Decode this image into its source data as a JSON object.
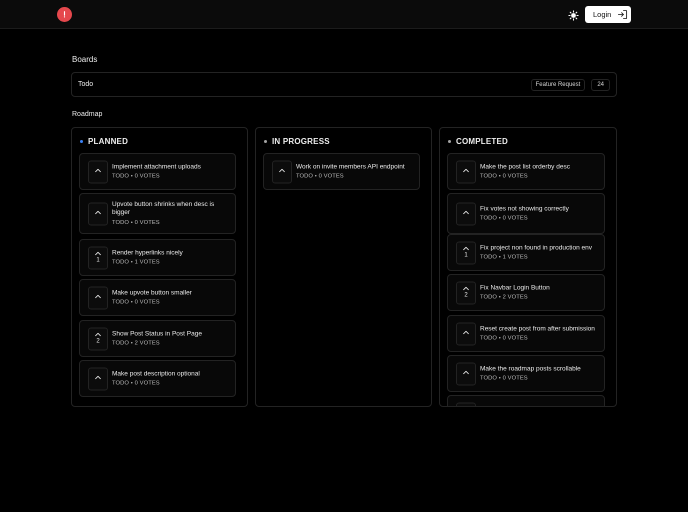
{
  "header": {
    "login_label": "Login"
  },
  "sections": {
    "boards": "Boards",
    "roadmap": "Roadmap"
  },
  "board": {
    "name": "Todo",
    "tag": "Feature Request",
    "count": "24"
  },
  "colors": {
    "accent_red": "#e5484d",
    "planned": "#3b82f6",
    "in_progress": "#a3a3a3",
    "completed": "#a3a3a3"
  },
  "columns": [
    {
      "title": "PLANNED",
      "cards": [
        {
          "title": "Implement attachment uploads",
          "meta": "TODO • 0 VOTES",
          "votes": ""
        },
        {
          "title": "Upvote button shrinks when desc is bigger",
          "meta": "TODO • 0 VOTES",
          "votes": ""
        },
        {
          "title": "Render hyperlinks nicely",
          "meta": "TODO • 1 VOTES",
          "votes": "1"
        },
        {
          "title": "Make upvote button smaller",
          "meta": "TODO • 0 VOTES",
          "votes": ""
        },
        {
          "title": "Show Post Status in Post Page",
          "meta": "TODO • 2 VOTES",
          "votes": "2"
        },
        {
          "title": "Make post description optional",
          "meta": "TODO • 0 VOTES",
          "votes": ""
        }
      ]
    },
    {
      "title": "IN PROGRESS",
      "cards": [
        {
          "title": "Work on invite members API endpoint",
          "meta": "TODO • 0 VOTES",
          "votes": ""
        }
      ]
    },
    {
      "title": "COMPLETED",
      "cards": [
        {
          "title": "Make the post list orderby desc",
          "meta": "TODO • 0 VOTES",
          "votes": ""
        },
        {
          "title": "Fix votes not showing correctly",
          "meta": "TODO • 0 VOTES",
          "votes": ""
        },
        {
          "title": "Fix project non found in production env",
          "meta": "TODO • 1 VOTES",
          "votes": "1"
        },
        {
          "title": "Fix Navbar Login Button",
          "meta": "TODO • 2 VOTES",
          "votes": "2"
        },
        {
          "title": "Reset create post from after submission",
          "meta": "TODO • 0 VOTES",
          "votes": ""
        },
        {
          "title": "Make the roadmap posts scrollable",
          "meta": "TODO • 0 VOTES",
          "votes": ""
        },
        {
          "title": "",
          "meta": "",
          "votes": ""
        }
      ]
    }
  ]
}
